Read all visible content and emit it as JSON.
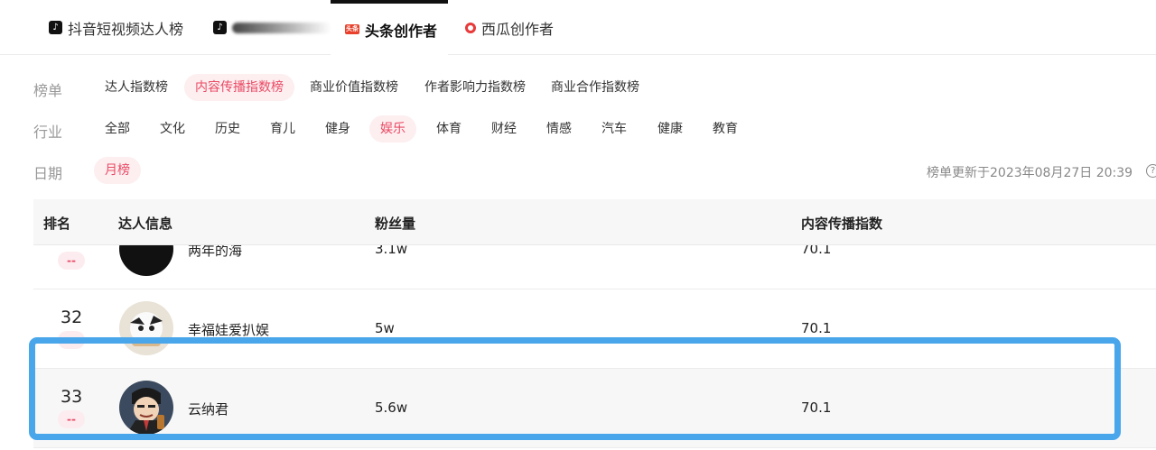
{
  "tabs": [
    {
      "label": "抖音短视频达人榜",
      "icon": "douyin-icon"
    },
    {
      "label": "",
      "icon": "douyin-icon",
      "blurred": true
    },
    {
      "label": "头条创作者",
      "icon": "toutiao-icon",
      "active": true,
      "icon_text": "头条"
    },
    {
      "label": "西瓜创作者",
      "icon": "xigua-icon"
    }
  ],
  "filters": {
    "list_label": "榜单",
    "list_options": [
      "达人指数榜",
      "内容传播指数榜",
      "商业价值指数榜",
      "作者影响力指数榜",
      "商业合作指数榜"
    ],
    "list_selected": "内容传播指数榜",
    "industry_label": "行业",
    "industry_options": [
      "全部",
      "文化",
      "历史",
      "育儿",
      "健身",
      "娱乐",
      "体育",
      "财经",
      "情感",
      "汽车",
      "健康",
      "教育"
    ],
    "industry_selected": "娱乐",
    "date_label": "日期",
    "date_options": [
      "月榜"
    ],
    "date_selected": "月榜"
  },
  "update_text": "榜单更新于2023年08月27日 20:39",
  "table": {
    "headers": [
      "排名",
      "达人信息",
      "粉丝量",
      "内容传播指数"
    ],
    "rows": [
      {
        "rank": "",
        "trend": "--",
        "name": "两年的海",
        "fans": "3.1w",
        "index": "70.1"
      },
      {
        "rank": "32",
        "trend": "--",
        "name": "幸福娃爱扒娱",
        "fans": "5w",
        "index": "70.1"
      },
      {
        "rank": "33",
        "trend": "--",
        "name": "云纳君",
        "fans": "5.6w",
        "index": "70.1",
        "highlighted": true
      }
    ]
  },
  "colors": {
    "accent": "#e94a64",
    "accent_bg": "#fdeef0",
    "selection_border": "#4aa6ea"
  }
}
